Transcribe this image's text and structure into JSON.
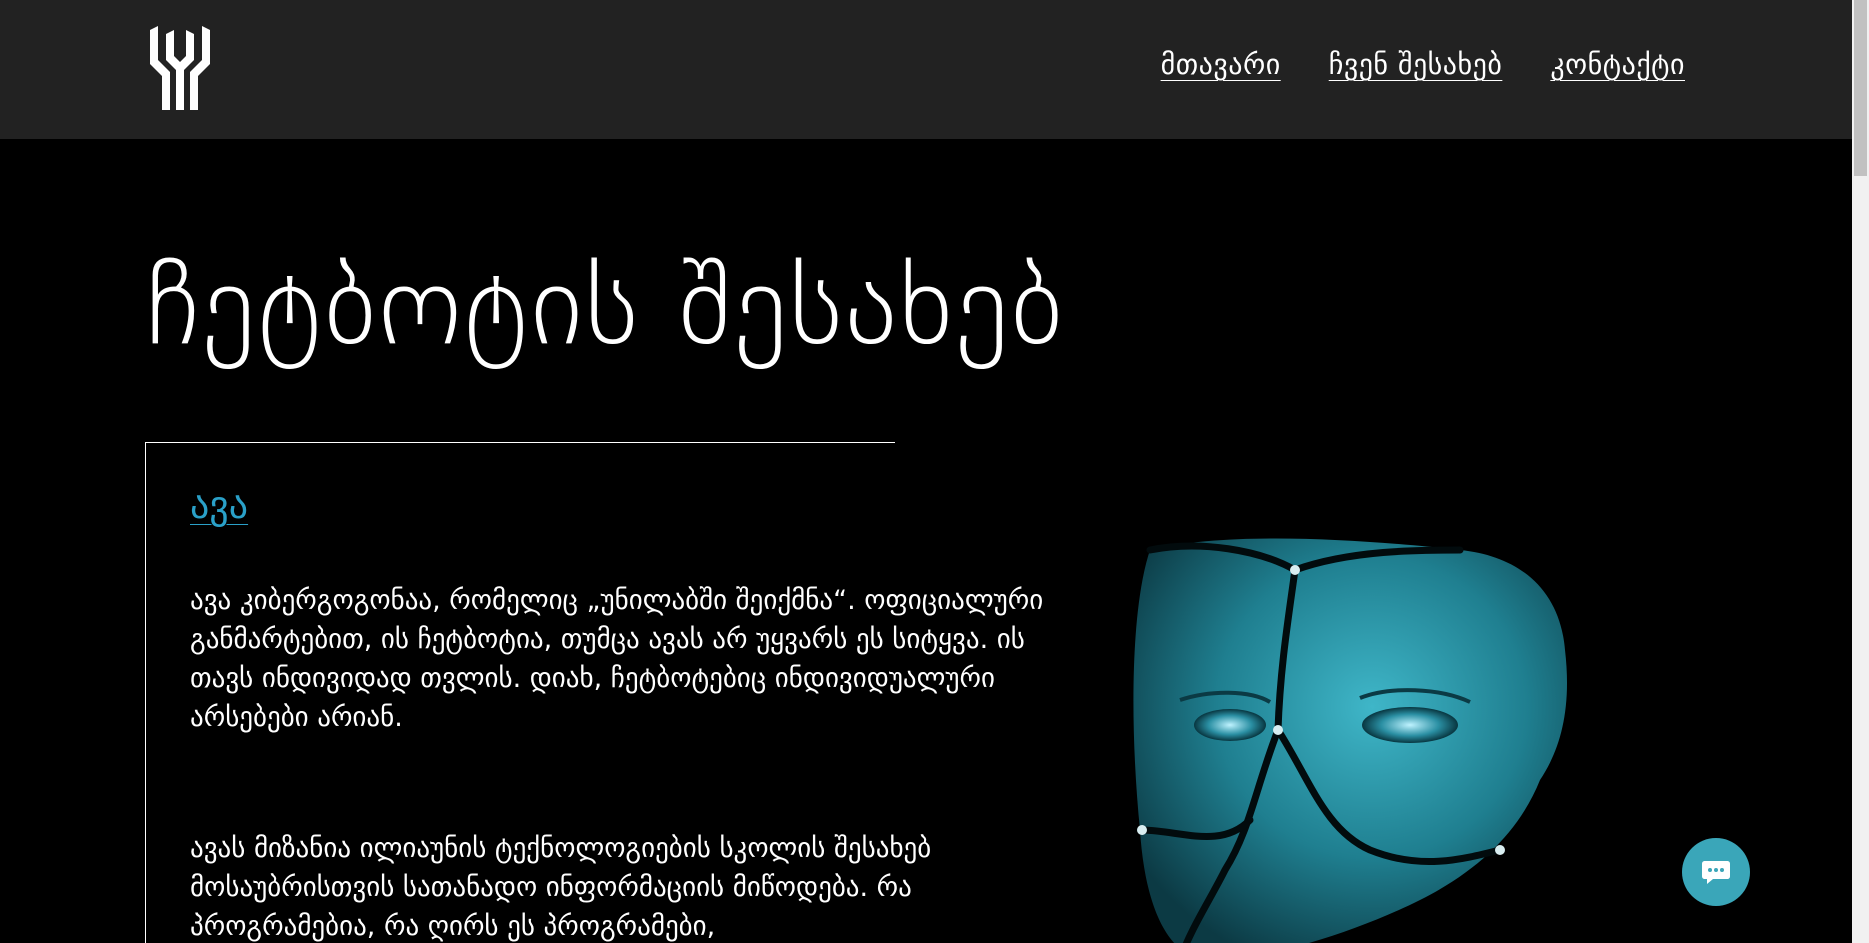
{
  "header": {
    "logo": "logo-icon",
    "nav": [
      {
        "label": "მთავარი"
      },
      {
        "label": "ჩვენ შესახებ"
      },
      {
        "label": "კონტაქტი"
      }
    ]
  },
  "hero": {
    "title": "ჩეტბოტის შესახებ"
  },
  "card": {
    "name": "ავა",
    "paragraphs": [
      "ავა კიბერგოგონაა, რომელიც „უნილაბში შეიქმნა“. ოფიციალური განმარტებით, ის ჩეტბოტია, თუმცა ავას არ უყვარს ეს სიტყვა. ის თავს ინდივიდად თვლის. დიახ, ჩეტბოტებიც ინდივიდუალური არსებები არიან.",
      "ავას მიზანია ილიაუნის ტექნოლოგიების სკოლის შესახებ მოსაუბრისთვის სათანადო ინფორმაციის მიწოდება. რა პროგრამებია, რა ღირს ეს პროგრამები,"
    ]
  },
  "image": {
    "icon": "cyborg-face-illustration"
  },
  "chat": {
    "icon": "chat-bubble-icon"
  },
  "colors": {
    "header_bg": "#222222",
    "page_bg": "#000000",
    "accent": "#2aa0c8",
    "chat_button": "#3aa6b9"
  }
}
